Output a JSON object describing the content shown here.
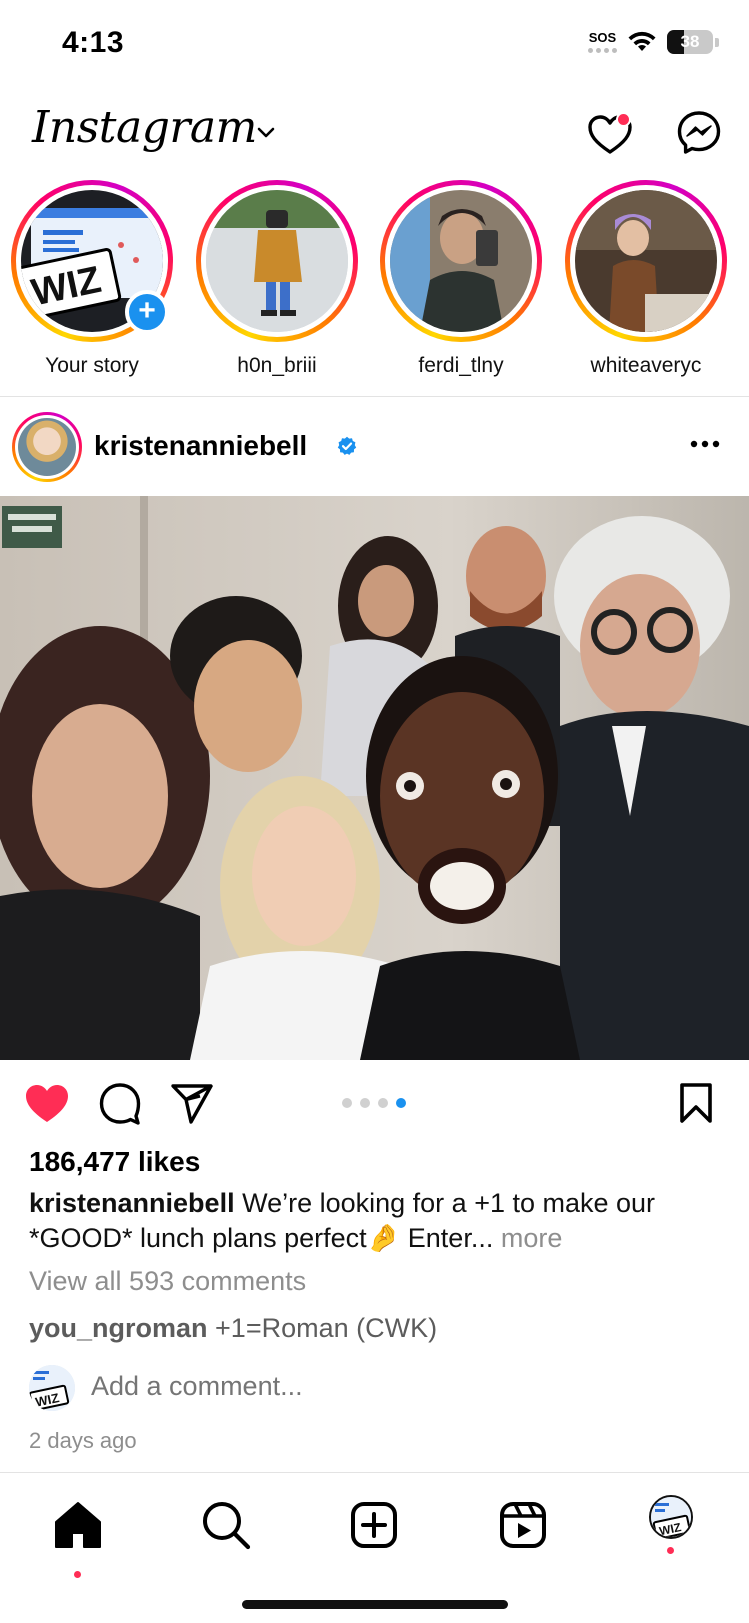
{
  "status_bar": {
    "time": "4:13",
    "sos": "SOS",
    "battery_level": "38",
    "battery_fraction": 0.38
  },
  "header": {
    "logo": "Instagram",
    "icons": [
      "chevron-down-icon",
      "heart-icon",
      "messenger-icon"
    ],
    "has_notification": true
  },
  "stories": [
    {
      "label": "Your story",
      "is_own": true
    },
    {
      "label": "h0n_briii"
    },
    {
      "label": "ferdi_tlny"
    },
    {
      "label": "whiteaveryc"
    }
  ],
  "post": {
    "username": "kristenanniebell",
    "verified": true,
    "carousel": {
      "count": 4,
      "active_index": 3
    },
    "liked": true,
    "likes_text": "186,477 likes",
    "caption_username": "kristenanniebell",
    "caption_text": " We’re looking for a +1 to make our *GOOD* lunch plans perfect🤌  Enter... ",
    "caption_more": "more",
    "view_comments": "View all 593 comments",
    "comment": {
      "username": "you_ngroman",
      "text": " +1=Roman (CWK)"
    },
    "add_comment_placeholder": "Add a comment...",
    "timestamp": "2 days ago"
  },
  "tabbar": {
    "items": [
      "home-icon",
      "search-icon",
      "create-post-icon",
      "reels-icon",
      "profile-avatar"
    ]
  },
  "colors": {
    "accent_blue": "#1a91ef",
    "like_red": "#ff2d55",
    "muted_gray": "#8e8e8e"
  }
}
